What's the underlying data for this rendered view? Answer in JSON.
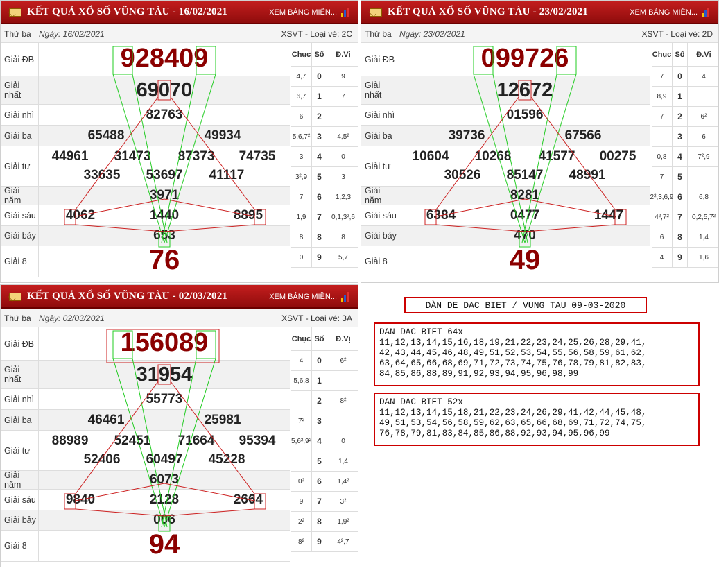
{
  "common": {
    "xem": "XEM BẢNG MIỀN...",
    "col_chuc": "Chục",
    "col_so": "Số",
    "col_dvi": "Đ.Vị"
  },
  "panels": [
    {
      "title": "KẾT QUẢ XỔ SỐ VŨNG TÀU - 16/02/2021",
      "day": "Thứ ba",
      "date": "Ngày: 16/02/2021",
      "code": "XSVT - Loại vé: 2C",
      "labels": [
        "Giải ĐB",
        "Giải nhất",
        "Giải nhì",
        "Giải ba",
        "Giải tư",
        "Giải năm",
        "Giải sáu",
        "Giải bảy",
        "Giải 8"
      ],
      "db": "928409",
      "nhat": "69070",
      "nhi": "82763",
      "ba": [
        "65488",
        "49934"
      ],
      "tu": [
        "44961",
        "31473",
        "87373",
        "74735",
        "33635",
        "53697",
        "41117"
      ],
      "nam": "3971",
      "sau": [
        "4062",
        "1440",
        "8895"
      ],
      "bay": "653",
      "tam": "76",
      "loto": [
        [
          "4,7",
          "0",
          "9"
        ],
        [
          "6,7",
          "1",
          "7"
        ],
        [
          "6",
          "2",
          ""
        ],
        [
          "5,6,7²",
          "3",
          "4,5²"
        ],
        [
          "3",
          "4",
          "0"
        ],
        [
          "3²,9",
          "5",
          "3"
        ],
        [
          "7",
          "6",
          "1,2,3"
        ],
        [
          "1,9",
          "7",
          "0,1,3²,6"
        ],
        [
          "8",
          "8",
          "8"
        ],
        [
          "0",
          "9",
          "5,7"
        ]
      ]
    },
    {
      "title": "KẾT QUẢ XỔ SỐ VŨNG TÀU - 23/02/2021",
      "day": "Thứ ba",
      "date": "Ngày: 23/02/2021",
      "code": "XSVT - Loại vé: 2D",
      "labels": [
        "Giải ĐB",
        "Giải nhất",
        "Giải nhì",
        "Giải ba",
        "Giải tư",
        "Giải năm",
        "Giải sáu",
        "Giải bảy",
        "Giải 8"
      ],
      "db": "099726",
      "nhat": "12672",
      "nhi": "01596",
      "ba": [
        "39736",
        "67566"
      ],
      "tu": [
        "10604",
        "10268",
        "41577",
        "00275",
        "30526",
        "85147",
        "48991"
      ],
      "nam": "8281",
      "sau": [
        "6384",
        "0477",
        "1447"
      ],
      "bay": "470",
      "tam": "49",
      "loto": [
        [
          "7",
          "0",
          "4"
        ],
        [
          "8,9",
          "1",
          ""
        ],
        [
          "7",
          "2",
          "6²"
        ],
        [
          "",
          "3",
          "6"
        ],
        [
          "0,8",
          "4",
          "7²,9"
        ],
        [
          "7",
          "5",
          ""
        ],
        [
          "2²,3,6,9",
          "6",
          "6,8"
        ],
        [
          "4²,7²",
          "7",
          "0,2,5,7²"
        ],
        [
          "6",
          "8",
          "1,4"
        ],
        [
          "4",
          "9",
          "1,6"
        ]
      ]
    },
    {
      "title": "KẾT QUẢ XỔ SỐ VŨNG TÀU - 02/03/2021",
      "day": "Thứ ba",
      "date": "Ngày: 02/03/2021",
      "code": "XSVT - Loại vé: 3A",
      "labels": [
        "Giải ĐB",
        "Giải nhất",
        "Giải nhì",
        "Giải ba",
        "Giải tư",
        "Giải năm",
        "Giải sáu",
        "Giải bảy",
        "Giải 8"
      ],
      "db": "156089",
      "nhat": "31954",
      "nhi": "55773",
      "ba": [
        "46461",
        "25981"
      ],
      "tu": [
        "88989",
        "52451",
        "71664",
        "95394",
        "52406",
        "60497",
        "45228"
      ],
      "nam": "6073",
      "sau": [
        "9840",
        "2128",
        "2664"
      ],
      "bay": "006",
      "tam": "94",
      "loto": [
        [
          "4",
          "0",
          "6²"
        ],
        [
          "5,6,8",
          "1",
          ""
        ],
        [
          "",
          "2",
          "8²"
        ],
        [
          "7²",
          "3",
          ""
        ],
        [
          "5,6²,9²",
          "4",
          "0"
        ],
        [
          "",
          "5",
          "1,4"
        ],
        [
          "0²",
          "6",
          "1,4²"
        ],
        [
          "9",
          "7",
          "3²"
        ],
        [
          "2²",
          "8",
          "1,9²"
        ],
        [
          "8²",
          "9",
          "4²,7"
        ]
      ]
    }
  ],
  "dan": {
    "title": "DÀN DE DAC BIET / VUNG TAU 09-03-2020",
    "box1": {
      "title": "DAN DAC BIET 64x",
      "lines": [
        "11,12,13,14,15,16,18,19,21,22,23,24,25,26,28,29,41,",
        "42,43,44,45,46,48,49,51,52,53,54,55,56,58,59,61,62,",
        "63,64,65,66,68,69,71,72,73,74,75,76,78,79,81,82,83,",
        "84,85,86,88,89,91,92,93,94,95,96,98,99"
      ]
    },
    "box2": {
      "title": "DAN DAC BIET 52x",
      "lines": [
        "11,12,13,14,15,18,21,22,23,24,26,29,41,42,44,45,48,",
        "49,51,53,54,56,58,59,62,63,65,66,68,69,71,72,74,75,",
        "76,78,79,81,83,84,85,86,88,92,93,94,95,96,99"
      ]
    }
  }
}
